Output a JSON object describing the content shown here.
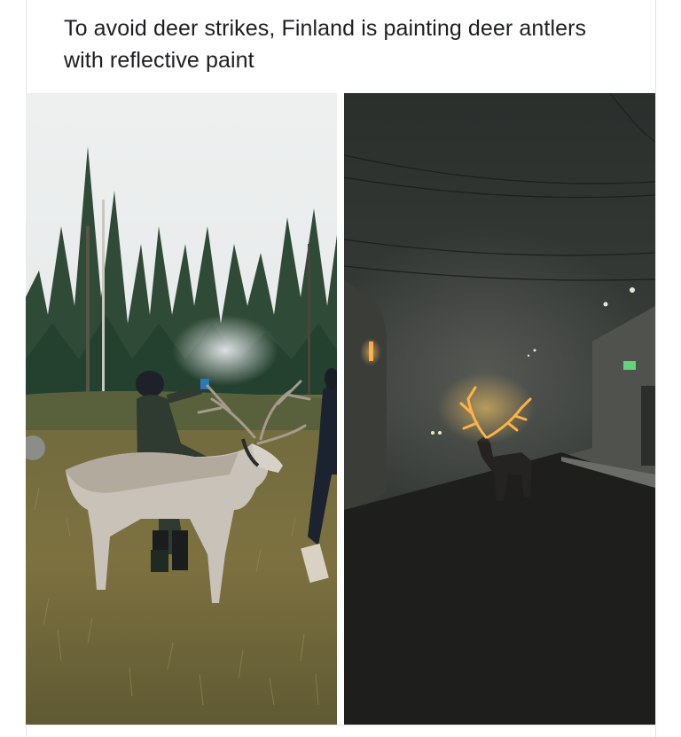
{
  "post": {
    "caption": "To avoid deer strikes, Finland is painting deer antlers with reflective paint"
  },
  "photos": {
    "left": {
      "icon": "daytime-reindeer-photo"
    },
    "right": {
      "icon": "night-glowing-reindeer-photo"
    }
  },
  "colors": {
    "text": "#1c1e21",
    "glow": "#ffb347",
    "night": "#1c1d1c"
  }
}
